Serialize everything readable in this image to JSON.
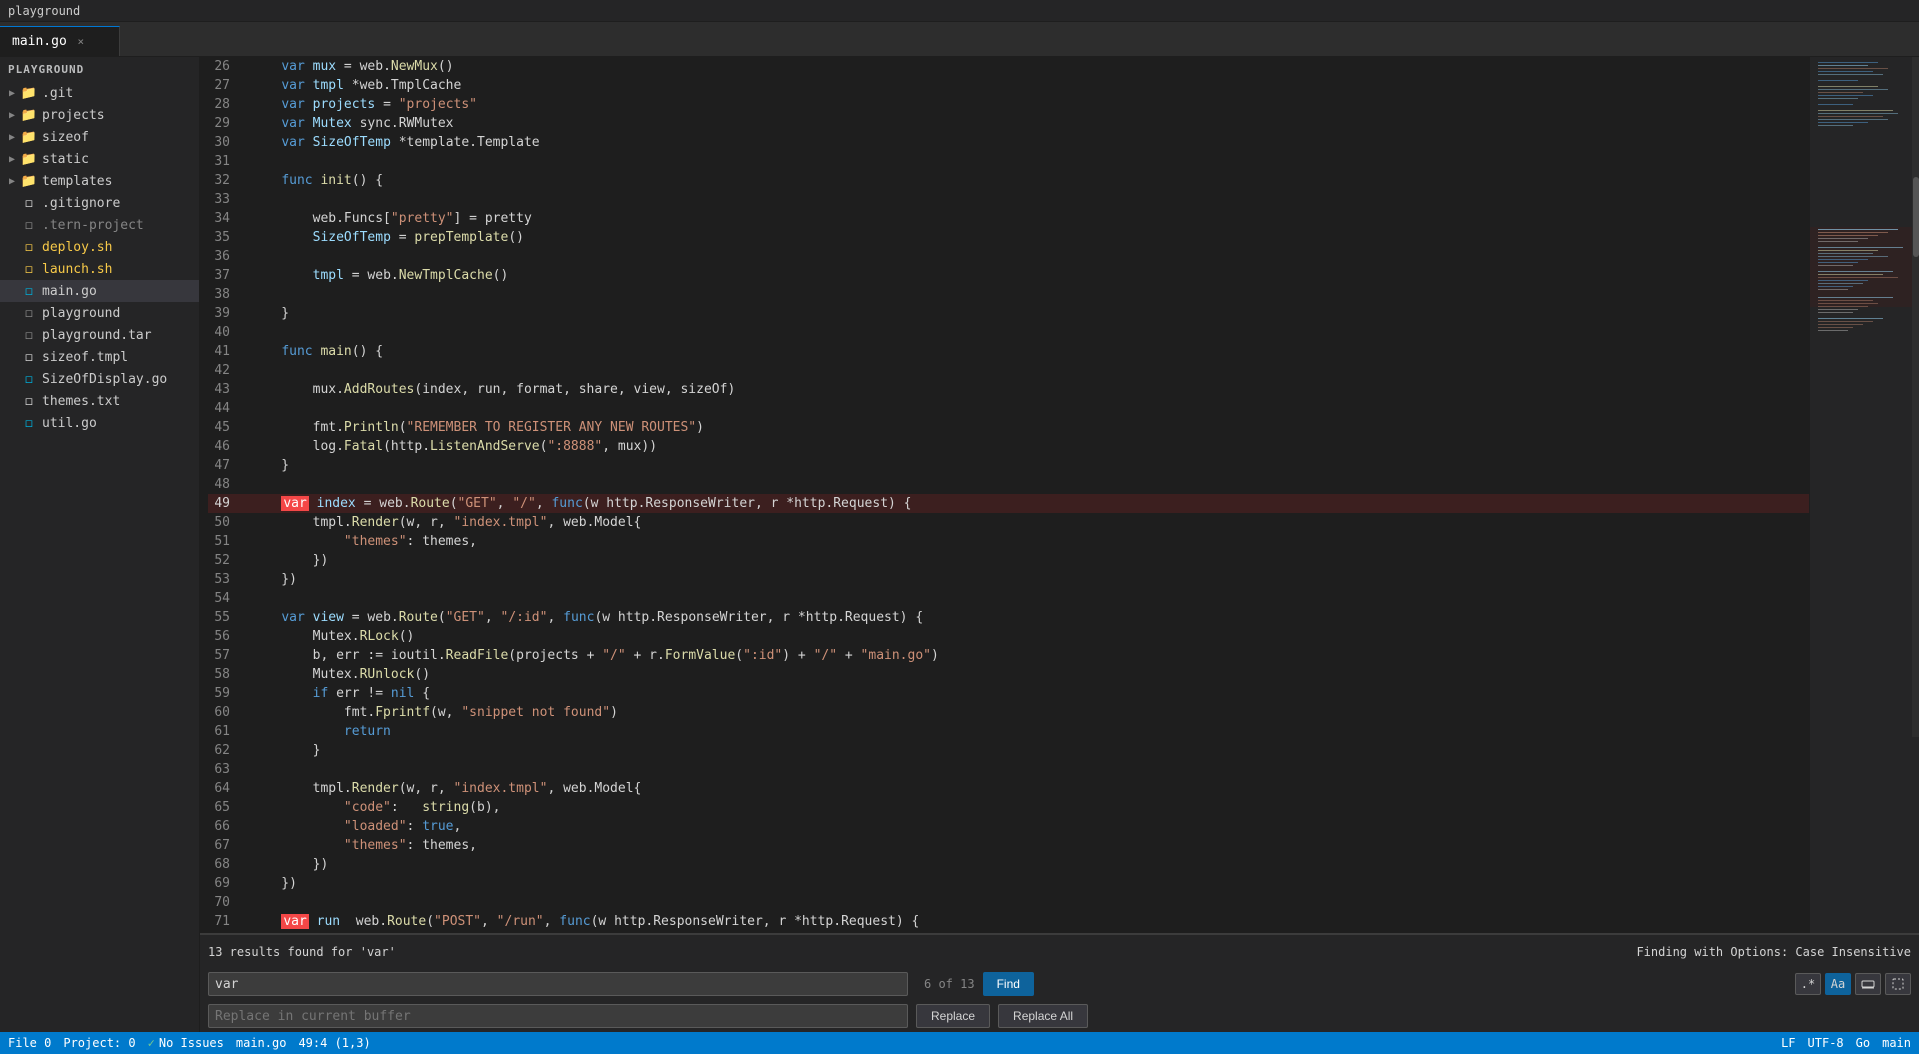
{
  "app": {
    "title": "playground"
  },
  "tab": {
    "filename": "main.go",
    "close_label": "×"
  },
  "sidebar": {
    "header": "playground",
    "items": [
      {
        "id": "git",
        "label": ".git",
        "indent": 1,
        "type": "folder",
        "arrow": "▶",
        "depth": 1
      },
      {
        "id": "projects",
        "label": "projects",
        "indent": 1,
        "type": "folder",
        "arrow": "▶",
        "depth": 1
      },
      {
        "id": "sizeof",
        "label": "sizeof",
        "indent": 1,
        "type": "folder",
        "arrow": "▶",
        "depth": 1
      },
      {
        "id": "static",
        "label": "static",
        "indent": 1,
        "type": "folder",
        "arrow": "▶",
        "depth": 1
      },
      {
        "id": "templates",
        "label": "templates",
        "indent": 1,
        "type": "folder",
        "arrow": "▶",
        "depth": 1
      },
      {
        "id": "gitignore",
        "label": ".gitignore",
        "indent": 1,
        "type": "file-git",
        "depth": 1
      },
      {
        "id": "tern-project",
        "label": ".tern-project",
        "indent": 1,
        "type": "file-dim",
        "depth": 1
      },
      {
        "id": "deploy-sh",
        "label": "deploy.sh",
        "indent": 1,
        "type": "file-sh",
        "depth": 1
      },
      {
        "id": "launch-sh",
        "label": "launch.sh",
        "indent": 1,
        "type": "file-sh2",
        "depth": 1
      },
      {
        "id": "main-go",
        "label": "main.go",
        "indent": 1,
        "type": "file-go-active",
        "depth": 1
      },
      {
        "id": "playground",
        "label": "playground",
        "indent": 1,
        "type": "file-dim",
        "depth": 1
      },
      {
        "id": "playground-tar",
        "label": "playground.tar",
        "indent": 1,
        "type": "file-dim",
        "depth": 1
      },
      {
        "id": "sizeof-tmpl",
        "label": "sizeof.tmpl",
        "indent": 1,
        "type": "file-tmpl",
        "depth": 1
      },
      {
        "id": "SizeOfDisplay-go",
        "label": "SizeOfDisplay.go",
        "indent": 1,
        "type": "file-go",
        "depth": 1
      },
      {
        "id": "themes-txt",
        "label": "themes.txt",
        "indent": 1,
        "type": "file-txt",
        "depth": 1
      },
      {
        "id": "util-go",
        "label": "util.go",
        "indent": 1,
        "type": "file-go",
        "depth": 1
      }
    ]
  },
  "code": {
    "lines": [
      {
        "num": 26,
        "content": "    var mux = web.NewMux()",
        "highlight": false
      },
      {
        "num": 27,
        "content": "    var tmpl *web.TmplCache",
        "highlight": false
      },
      {
        "num": 28,
        "content": "    var projects = \"projects\"",
        "highlight": false
      },
      {
        "num": 29,
        "content": "    var Mutex sync.RWMutex",
        "highlight": false
      },
      {
        "num": 30,
        "content": "    var SizeOfTemp *template.Template",
        "highlight": false
      },
      {
        "num": 31,
        "content": "",
        "highlight": false
      },
      {
        "num": 32,
        "content": "    func init() {",
        "highlight": false
      },
      {
        "num": 33,
        "content": "",
        "highlight": false
      },
      {
        "num": 34,
        "content": "        web.Funcs[\"pretty\"] = pretty",
        "highlight": false
      },
      {
        "num": 35,
        "content": "        SizeOfTemp = prepTemplate()",
        "highlight": false
      },
      {
        "num": 36,
        "content": "",
        "highlight": false
      },
      {
        "num": 37,
        "content": "        tmpl = web.NewTmplCache()",
        "highlight": false
      },
      {
        "num": 38,
        "content": "",
        "highlight": false
      },
      {
        "num": 39,
        "content": "    }",
        "highlight": false
      },
      {
        "num": 40,
        "content": "",
        "highlight": false
      },
      {
        "num": 41,
        "content": "    func main() {",
        "highlight": false
      },
      {
        "num": 42,
        "content": "",
        "highlight": false
      },
      {
        "num": 43,
        "content": "        mux.AddRoutes(index, run, format, share, view, sizeOf)",
        "highlight": false
      },
      {
        "num": 44,
        "content": "",
        "highlight": false
      },
      {
        "num": 45,
        "content": "        fmt.Println(\"REMEMBER TO REGISTER ANY NEW ROUTES\")",
        "highlight": false
      },
      {
        "num": 46,
        "content": "        log.Fatal(http.ListenAndServe(\":8888\", mux))",
        "highlight": false
      },
      {
        "num": 47,
        "content": "    }",
        "highlight": false
      },
      {
        "num": 48,
        "content": "",
        "highlight": false
      },
      {
        "num": 49,
        "content": "    var index = web.Route(\"GET\", \"/\", func(w http.ResponseWriter, r *http.Request) {",
        "highlight": true
      },
      {
        "num": 50,
        "content": "        tmpl.Render(w, r, \"index.tmpl\", web.Model{",
        "highlight": false
      },
      {
        "num": 51,
        "content": "            \"themes\": themes,",
        "highlight": false
      },
      {
        "num": 52,
        "content": "        })",
        "highlight": false
      },
      {
        "num": 53,
        "content": "    })",
        "highlight": false
      },
      {
        "num": 54,
        "content": "",
        "highlight": false
      },
      {
        "num": 55,
        "content": "    var view = web.Route(\"GET\", \"/:id\", func(w http.ResponseWriter, r *http.Request) {",
        "highlight": false
      },
      {
        "num": 56,
        "content": "        Mutex.RLock()",
        "highlight": false
      },
      {
        "num": 57,
        "content": "        b, err := ioutil.ReadFile(projects + \"/\" + r.FormValue(\":id\") + \"/\" + \"main.go\")",
        "highlight": false
      },
      {
        "num": 58,
        "content": "        Mutex.RUnlock()",
        "highlight": false
      },
      {
        "num": 59,
        "content": "        if err != nil {",
        "highlight": false
      },
      {
        "num": 60,
        "content": "            fmt.Fprintf(w, \"snippet not found\")",
        "highlight": false
      },
      {
        "num": 61,
        "content": "            return",
        "highlight": false
      },
      {
        "num": 62,
        "content": "        }",
        "highlight": false
      },
      {
        "num": 63,
        "content": "",
        "highlight": false
      },
      {
        "num": 64,
        "content": "        tmpl.Render(w, r, \"index.tmpl\", web.Model{",
        "highlight": false
      },
      {
        "num": 65,
        "content": "            \"code\":   string(b),",
        "highlight": false
      },
      {
        "num": 66,
        "content": "            \"loaded\": true,",
        "highlight": false
      },
      {
        "num": 67,
        "content": "            \"themes\": themes,",
        "highlight": false
      },
      {
        "num": 68,
        "content": "        })",
        "highlight": false
      },
      {
        "num": 69,
        "content": "    })",
        "highlight": false
      },
      {
        "num": 70,
        "content": "",
        "highlight": false
      },
      {
        "num": 71,
        "content": "    var run  web.Route(\"POST\", \"/run\", func(w http.ResponseWriter, r *http.Request) {",
        "highlight": false
      }
    ]
  },
  "search": {
    "result_info": "13 results found for 'var'",
    "find_value": "var",
    "replace_placeholder": "Replace in current buffer",
    "counter": "6 of 13",
    "find_btn_label": "Find",
    "replace_btn_label": "Replace",
    "replace_all_btn_label": "Replace All",
    "options_label": "Finding with Options:",
    "options_value": "Case Insensitive"
  },
  "status_bar": {
    "file_num": "File 0",
    "project": "Project: 0",
    "issues": "No Issues",
    "file": "main.go",
    "position": "49:4 (1,3)",
    "encoding": "LF",
    "charset": "UTF-8",
    "language": "Go",
    "extra": "main"
  }
}
